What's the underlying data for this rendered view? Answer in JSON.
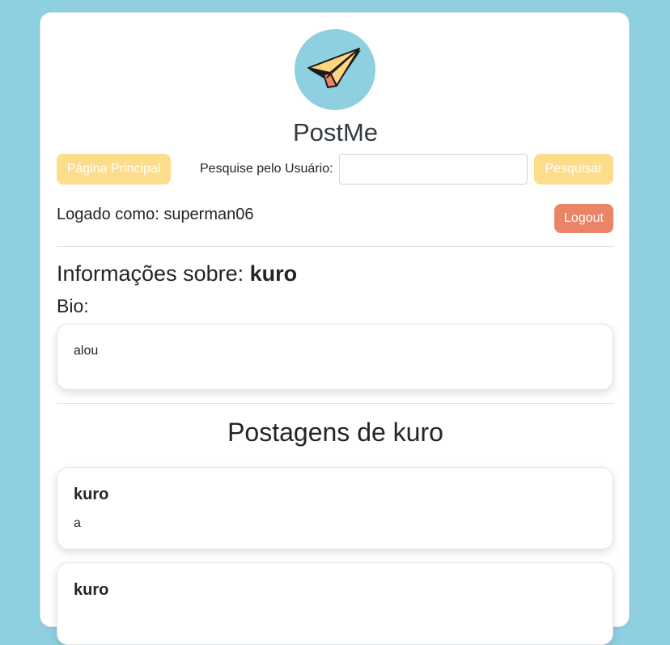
{
  "app": {
    "title": "PostMe",
    "logo_icon": "paper-plane-icon"
  },
  "nav": {
    "home_label": "Página Principal",
    "search_label": "Pesquise pelo Usuário:",
    "search_value": "",
    "search_placeholder": "",
    "search_button_label": "Pesquisar"
  },
  "session": {
    "logged_as": "Logado como: superman06",
    "logout_label": "Logout"
  },
  "profile": {
    "heading_prefix": "Informações sobre: ",
    "username": "kuro",
    "bio_label": "Bio:",
    "bio_text": "alou"
  },
  "posts": {
    "heading": "Postagens de kuro",
    "items": [
      {
        "author": "kuro",
        "content": "a"
      },
      {
        "author": "kuro",
        "content": ""
      }
    ]
  },
  "colors": {
    "background": "#8ecfe0",
    "primary_button": "#fddc8b",
    "logout_button": "#ea8466"
  }
}
